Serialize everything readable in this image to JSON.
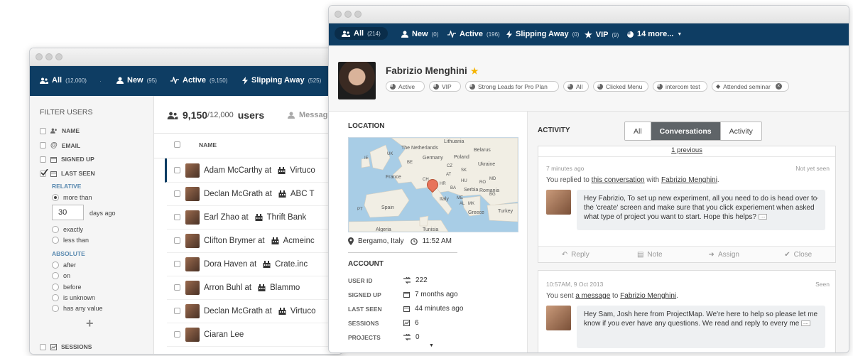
{
  "back_window": {
    "nav": [
      {
        "label": "All",
        "count": "(12,000)",
        "icon": "users-icon"
      },
      {
        "label": "New",
        "count": "(95)",
        "icon": "user-icon"
      },
      {
        "label": "Active",
        "count": "(9,150)",
        "icon": "pulse-icon"
      },
      {
        "label": "Slipping Away",
        "count": "(525)",
        "icon": "bolt-icon"
      }
    ],
    "sidebar": {
      "title": "FILTER USERS",
      "filters": [
        "NAME",
        "EMAIL",
        "SIGNED UP",
        "LAST SEEN"
      ],
      "relative_label": "RELATIVE",
      "relative_options": [
        "more than",
        "exactly",
        "less than"
      ],
      "days_value": "30",
      "days_suffix": "days ago",
      "absolute_label": "ABSOLUTE",
      "absolute_options": [
        "after",
        "on",
        "before",
        "is unknown",
        "has any value"
      ],
      "add_symbol": "+",
      "sessions_label": "SESSIONS"
    },
    "list": {
      "count": "9,150",
      "total": "/12,000",
      "users_word": "users",
      "message_label": "Messag",
      "column_name": "NAME",
      "rows": [
        {
          "name": "Adam McCarthy at",
          "company": "Virtuco"
        },
        {
          "name": "Declan McGrath at",
          "company": "ABC T"
        },
        {
          "name": "Earl Zhao at",
          "company": "Thrift Bank"
        },
        {
          "name": "Clifton Brymer at",
          "company": "Acmeinc"
        },
        {
          "name": "Dora Haven at",
          "company": "Crate.inc"
        },
        {
          "name": "Arron Buhl at",
          "company": "Blammo"
        },
        {
          "name": "Declan McGrath at",
          "company": "Virtuco"
        },
        {
          "name": "Ciaran Lee",
          "company": ""
        }
      ]
    }
  },
  "front_window": {
    "nav": [
      {
        "label": "All",
        "count": "(214)",
        "icon": "users-icon"
      },
      {
        "label": "New",
        "count": "(0)",
        "icon": "user-icon"
      },
      {
        "label": "Active",
        "count": "(196)",
        "icon": "pulse-icon"
      },
      {
        "label": "Slipping Away",
        "count": "(0)",
        "icon": "bolt-icon"
      },
      {
        "label": "VIP",
        "count": "(9)",
        "icon": "star-icon"
      },
      {
        "label": "14 more...",
        "count": "",
        "icon": "pie-icon"
      }
    ],
    "profile": {
      "name": "Fabrizio Menghini",
      "star": "★",
      "star_color": "#f5b400",
      "tags": [
        "Active",
        "VIP",
        "Strong Leads for Pro Plan",
        "All",
        "Clicked Menu",
        "intercom test",
        "Attended seminar"
      ]
    },
    "location": {
      "title": "LOCATION",
      "city": "Bergamo, Italy",
      "time": "11:52 AM",
      "map_labels": [
        "Lithuania",
        "Belarus",
        "The Netherlands",
        "Poland",
        "UK",
        "IE",
        "Germany",
        "Ukraine",
        "France",
        "CH",
        "AT",
        "CZ",
        "SK",
        "HU",
        "RO",
        "Italy",
        "Serbia",
        "BG",
        "Spain",
        "PT",
        "Greece",
        "Turkey",
        "Tunisia",
        "Algeria",
        "Romania",
        "MD",
        "BE",
        "BA",
        "HR",
        "ME",
        "AL",
        "MK"
      ]
    },
    "account": {
      "title": "ACCOUNT",
      "rows": [
        {
          "label": "USER ID",
          "value": "222",
          "icon": "shuffle-icon"
        },
        {
          "label": "SIGNED UP",
          "value": "7 months ago",
          "icon": "calendar-icon"
        },
        {
          "label": "LAST SEEN",
          "value": "44 minutes ago",
          "icon": "calendar-icon"
        },
        {
          "label": "SESSIONS",
          "value": "6",
          "icon": "chart-icon"
        },
        {
          "label": "PROJECTS",
          "value": "0",
          "icon": "shuffle-icon"
        }
      ]
    },
    "activity": {
      "title": "ACTIVITY",
      "tabs": [
        "All",
        "Conversations",
        "Activity"
      ],
      "active_tab": "Conversations",
      "previous_label": "1 previous",
      "conv1": {
        "time": "7 minutes ago",
        "status": "Not yet seen",
        "prefix": "You replied to",
        "link": "this conversation",
        "mid": "with",
        "person": "Fabrizio Menghini",
        "end": ".",
        "body": "Hey Fabrizio, To set up new experiment, all you need to do is head over to the 'create' screen and make sure that you click experiement when asked what type of project you want to start. Hope this helps?",
        "more": "...."
      },
      "actions": [
        "Reply",
        "Note",
        "Assign",
        "Close"
      ],
      "conv2": {
        "time": "10:57AM, 9 Oct 2013",
        "status": "Seen",
        "prefix": "You sent",
        "link": "a message",
        "mid": "to",
        "person": "Fabrizio Menghini",
        "end": ".",
        "body": "Hey Sam, Josh here from ProjectMap. We're here to help so please let me know if you ever have any questions. We read and reply to every me",
        "more": "...."
      }
    }
  },
  "colors": {
    "nav_bg": "#0e3d63",
    "accent": "#0e3d63",
    "pin": "#e8735a",
    "map_sea": "#a8cde6",
    "map_land": "#f1eee4"
  }
}
